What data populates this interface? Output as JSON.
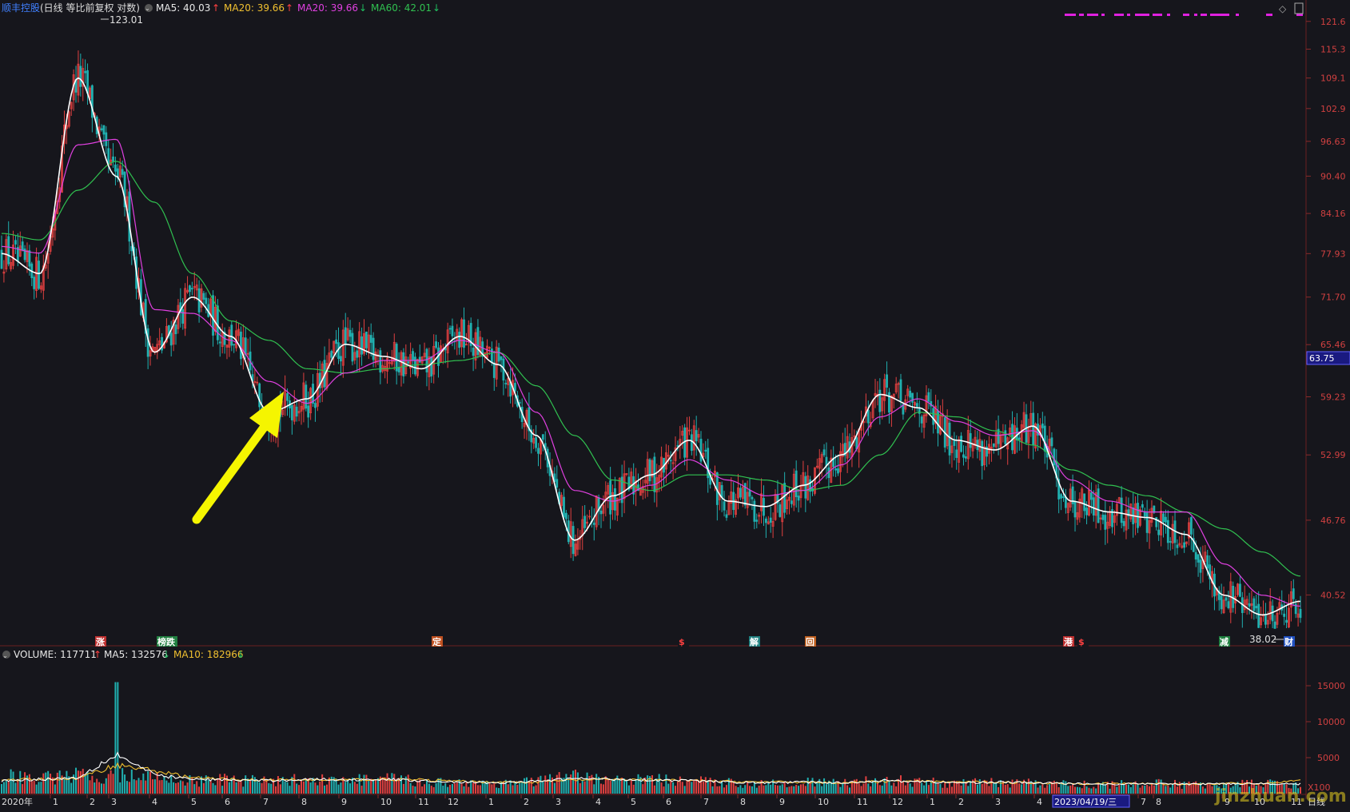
{
  "header": {
    "stock_name": "顺丰控股",
    "chart_mode": "(日线 等比前复权 对数)",
    "ma_items": [
      {
        "label": "MA5: 40.03",
        "arrow": "↑",
        "color": "#e8e8e8",
        "arrow_color": "#ff4040"
      },
      {
        "label": "MA20: 39.66",
        "arrow": "↑",
        "color": "#f0c030",
        "arrow_color": "#ff4040"
      },
      {
        "label": "MA20: 39.66",
        "arrow": "↓",
        "color": "#e040e0",
        "arrow_color": "#20c060"
      },
      {
        "label": "MA60: 42.01",
        "arrow": "↓",
        "color": "#30c050",
        "arrow_color": "#20c060"
      }
    ]
  },
  "volume_header": {
    "label": "VOLUME: 117711",
    "arrow": "↑",
    "ma5": "MA5: 132576",
    "ma5_arrow": "↓",
    "ma10": "MA10: 182966",
    "ma10_arrow": "↓"
  },
  "price_axis": {
    "ticks": [
      121.6,
      115.3,
      109.1,
      102.9,
      96.63,
      90.4,
      84.16,
      77.93,
      71.7,
      65.46,
      59.23,
      52.99,
      46.76,
      40.52
    ],
    "tick_labels": [
      "121.6",
      "115.3",
      "109.1",
      "102.9",
      "96.63",
      "90.40",
      "84.16",
      "77.93",
      "71.70",
      "65.46",
      "59.23",
      "52.99",
      "46.76",
      "40.52"
    ],
    "current_price": "63.75"
  },
  "volume_axis": {
    "tick_labels": [
      "15000",
      "10000",
      "5000"
    ],
    "unit": "X100"
  },
  "time_axis": {
    "labels": [
      "2020年",
      "1",
      "2",
      "3",
      "4",
      "5",
      "6",
      "7",
      "8",
      "9",
      "10",
      "11",
      "12",
      "1",
      "2",
      "3",
      "4",
      "5",
      "6",
      "7",
      "8",
      "9",
      "10",
      "11",
      "12",
      "1",
      "2",
      "3",
      "4",
      "2023/04/19/三",
      "7",
      "8",
      "9",
      "10",
      "11",
      "日线"
    ]
  },
  "annotations": {
    "high_label": "123.01",
    "low_label": "38.02"
  },
  "event_markers": [
    {
      "text": "涨",
      "bg": "#c03030",
      "fg": "#ffffff"
    },
    {
      "text": "榜跌",
      "bg": "#208040",
      "fg": "#ffffff"
    },
    {
      "text": "定",
      "bg": "#c05020",
      "fg": "#ffffff"
    },
    {
      "text": "$",
      "bg": "#16161c",
      "fg": "#ff4040"
    },
    {
      "text": "解",
      "bg": "#208080",
      "fg": "#ffffff"
    },
    {
      "text": "回",
      "bg": "#c06020",
      "fg": "#ffffff"
    },
    {
      "text": "港",
      "bg": "#c03030",
      "fg": "#ffffff"
    },
    {
      "text": "$",
      "bg": "#16161c",
      "fg": "#ff4040"
    },
    {
      "text": "减",
      "bg": "#208040",
      "fg": "#ffffff"
    },
    {
      "text": "财",
      "bg": "#2050c0",
      "fg": "#ffffff"
    }
  ],
  "watermark": "jinzhuan.com",
  "colors": {
    "background": "#16161c",
    "grid": "#3a1a1a",
    "up": "#e04040",
    "down": "#20b0b0",
    "ma5": "#ffffff",
    "ma20": "#e040e0",
    "ma60": "#30c050",
    "volume_ma5": "#ffffff",
    "volume_ma10": "#f0c030",
    "arrow": "#f5f500",
    "axis_text": "#d04040",
    "title": "#4080ff"
  },
  "chart_data": [
    {
      "type": "line",
      "title": "顺丰控股 (日线 等比前复权 对数)",
      "xlabel": "",
      "ylabel": "",
      "y_scale": "log",
      "ylim": [
        37.5,
        124
      ],
      "x": [
        "2020-01",
        "2020-02",
        "2020-03",
        "2020-04",
        "2020-05",
        "2020-06",
        "2020-07",
        "2020-08",
        "2020-09",
        "2020-10",
        "2020-11",
        "2020-12",
        "2021-01",
        "2021-02",
        "2021-03",
        "2021-04",
        "2021-05",
        "2021-06",
        "2021-07",
        "2021-08",
        "2021-09",
        "2021-10",
        "2021-11",
        "2021-12",
        "2022-01",
        "2022-02",
        "2022-03",
        "2022-04",
        "2022-05",
        "2022-06",
        "2022-07",
        "2022-08",
        "2022-09",
        "2022-10",
        "2022-11"
      ],
      "series": [
        {
          "name": "MA5",
          "values": [
            77.93,
            75.0,
            109.1,
            90.4,
            64.5,
            71.7,
            66.5,
            57.5,
            59.0,
            65.5,
            64.0,
            62.5,
            66.5,
            63.0,
            55.0,
            45.0,
            49.0,
            51.0,
            54.5,
            48.5,
            48.0,
            50.0,
            53.0,
            59.5,
            58.0,
            54.5,
            53.5,
            56.0,
            48.5,
            47.5,
            47.0,
            45.5,
            40.5,
            39.0,
            40.03
          ]
        },
        {
          "name": "MA20",
          "values": [
            79.0,
            78.0,
            96.0,
            97.0,
            70.0,
            69.5,
            66.0,
            61.0,
            58.5,
            62.0,
            63.5,
            63.5,
            66.0,
            64.5,
            57.5,
            49.5,
            48.5,
            50.0,
            52.5,
            50.5,
            49.0,
            49.5,
            52.0,
            57.0,
            59.0,
            56.5,
            55.0,
            55.5,
            50.5,
            48.5,
            47.5,
            47.5,
            43.0,
            40.5,
            39.66
          ]
        },
        {
          "name": "MA60",
          "values": [
            81.0,
            80.0,
            88.0,
            93.0,
            86.0,
            75.0,
            68.5,
            66.0,
            62.5,
            62.0,
            62.5,
            63.0,
            63.5,
            64.5,
            60.5,
            55.0,
            50.5,
            49.5,
            51.0,
            51.0,
            50.5,
            49.5,
            50.0,
            53.0,
            57.5,
            57.0,
            55.5,
            54.0,
            51.5,
            50.0,
            49.0,
            47.5,
            46.0,
            44.0,
            42.01
          ]
        }
      ],
      "high": 123.01,
      "low": 38.02,
      "legend": "top-left",
      "grid": false
    },
    {
      "type": "bar",
      "title": "VOLUME",
      "ylim": [
        0,
        17000
      ],
      "y_unit": "X100",
      "categories": [
        "2020-01",
        "2020-02",
        "2020-03",
        "2020-04",
        "2020-05",
        "2020-06",
        "2020-07",
        "2020-08",
        "2020-09",
        "2020-10",
        "2020-11",
        "2020-12",
        "2021-01",
        "2021-02",
        "2021-03",
        "2021-04",
        "2021-05",
        "2021-06",
        "2021-07",
        "2021-08",
        "2021-09",
        "2021-10",
        "2021-11",
        "2021-12",
        "2022-01",
        "2022-02",
        "2022-03",
        "2022-04",
        "2022-05",
        "2022-06",
        "2022-07",
        "2022-08",
        "2022-09",
        "2022-10",
        "2022-11"
      ],
      "values": [
        2500,
        2200,
        2600,
        15500,
        2200,
        1900,
        2000,
        1800,
        2100,
        1900,
        2200,
        1700,
        1600,
        1500,
        1800,
        2400,
        1900,
        2000,
        1800,
        1600,
        1500,
        1700,
        1400,
        2000,
        1700,
        1500,
        1600,
        1500,
        1400,
        1300,
        1500,
        1300,
        1400,
        1500,
        1177
      ],
      "series": [
        {
          "name": "MA5",
          "values": [
            1800,
            2000,
            2200,
            5500,
            2600,
            2000,
            1900,
            1800,
            2000,
            1900,
            2000,
            1800,
            1600,
            1500,
            1700,
            2100,
            2000,
            1900,
            1800,
            1600,
            1500,
            1600,
            1500,
            1800,
            1700,
            1500,
            1600,
            1500,
            1400,
            1300,
            1400,
            1300,
            1400,
            1400,
            1326
          ]
        },
        {
          "name": "MA10",
          "values": [
            1900,
            2000,
            2100,
            4000,
            3200,
            2200,
            2000,
            1900,
            1900,
            1900,
            2000,
            1900,
            1700,
            1600,
            1600,
            1900,
            2000,
            1900,
            1800,
            1700,
            1600,
            1600,
            1500,
            1700,
            1700,
            1600,
            1600,
            1500,
            1400,
            1400,
            1400,
            1300,
            1400,
            1400,
            1830
          ]
        }
      ]
    }
  ]
}
